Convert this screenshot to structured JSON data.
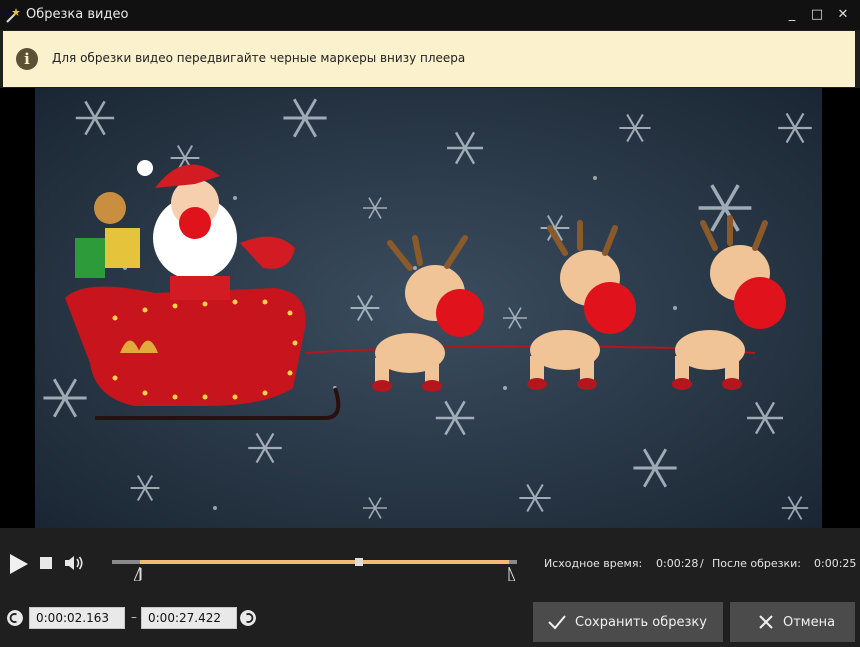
{
  "window": {
    "title": "Обрезка видео"
  },
  "titlebar": {
    "minimize": "_",
    "maximize": "□",
    "close": "✕"
  },
  "hint": {
    "text": "Для обрезки видео передвигайте черные маркеры внизу плеера",
    "icon": "info-icon"
  },
  "player": {
    "progress": {
      "start_fraction": 0.07,
      "end_fraction": 0.98,
      "playhead_fraction": 0.61
    },
    "original_time_label": "Исходное время:",
    "original_time": "0:00:28",
    "separator": "/",
    "after_trim_label": "После обрезки:",
    "after_trim_time": "0:00:25"
  },
  "trim": {
    "start_value": "0:00:02.163",
    "dash": "–",
    "end_value": "0:00:27.422"
  },
  "buttons": {
    "save_label": "Сохранить обрезку",
    "cancel_label": "Отмена"
  },
  "colors": {
    "accent": "#f1ba76",
    "tip_bg": "#fbf1cc",
    "button_bg": "#4b4b4b"
  }
}
